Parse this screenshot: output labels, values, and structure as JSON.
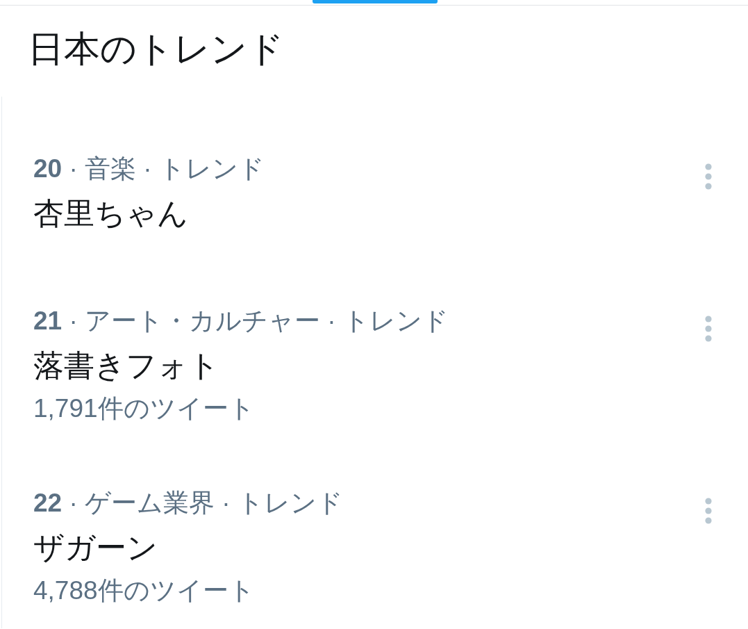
{
  "header": {
    "title": "日本のトレンド"
  },
  "trends": [
    {
      "context": "**20** · 音楽 · トレンド",
      "name": "杏里ちゃん"
    },
    {
      "context": "**21** · アート・カルチャー · トレンド",
      "name": "落書きフォト",
      "tweet_count": "1,791件のツイート"
    },
    {
      "context": "**22** · ゲーム業界 · トレンド",
      "name": "ザガーン",
      "tweet_count": "4,788件のツイート"
    }
  ]
}
